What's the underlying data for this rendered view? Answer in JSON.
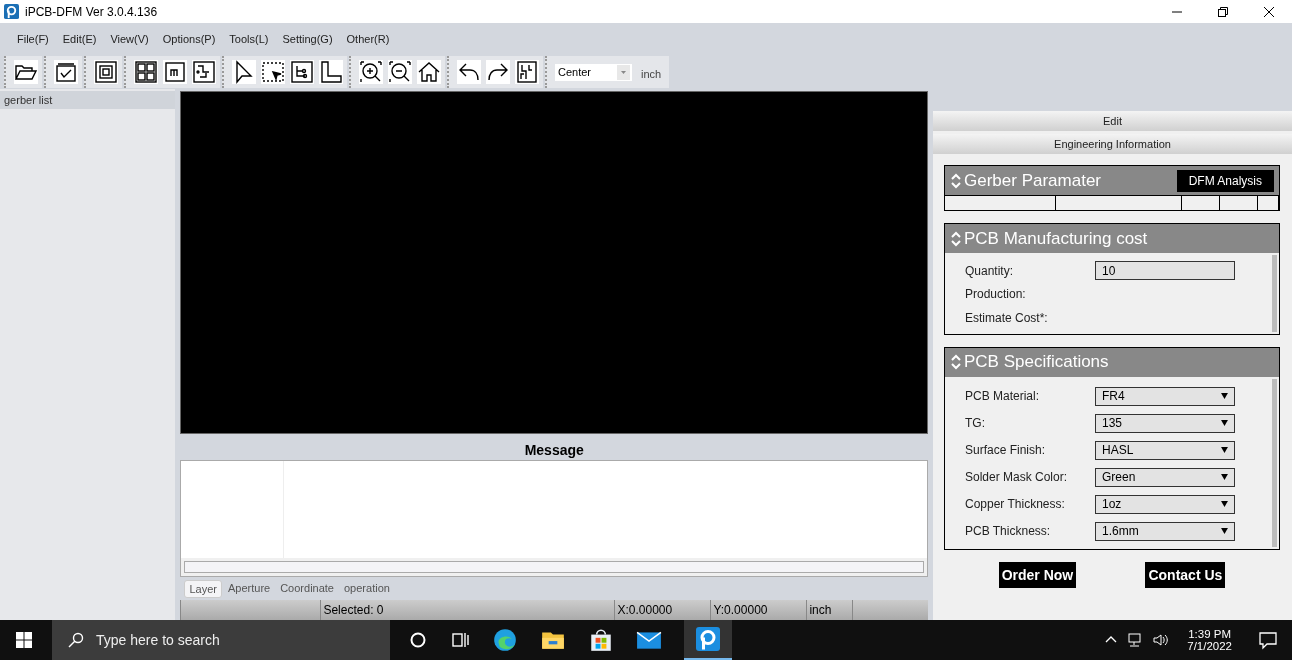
{
  "window": {
    "title": "iPCB-DFM Ver 3.0.4.136"
  },
  "menu": [
    "File(F)",
    "Edit(E)",
    "View(V)",
    "Options(P)",
    "Tools(L)",
    "Setting(G)",
    "Other(R)"
  ],
  "toolbar": {
    "origin": "Center",
    "unit": "inch"
  },
  "sidebar": {
    "title": "gerber list"
  },
  "message": {
    "title": "Message"
  },
  "tabs": [
    {
      "label": "Layer",
      "selected": true
    },
    {
      "label": "Aperture",
      "selected": false
    },
    {
      "label": "Coordinate",
      "selected": false
    },
    {
      "label": "operation",
      "selected": false
    }
  ],
  "status_bar": {
    "selected": "Selected: 0",
    "x": "X:0.00000",
    "y": "Y:0.00000",
    "unit": "inch"
  },
  "right_panel": {
    "bars": [
      "Edit",
      "Engineering Information"
    ],
    "gerber": {
      "title": "Gerber Paramater",
      "button": "DFM Analysis"
    },
    "cost": {
      "title": "PCB Manufacturing cost",
      "fields": [
        {
          "kind": "input",
          "label": "Quantity:",
          "value": "10"
        },
        {
          "kind": "label",
          "label": "Production:"
        },
        {
          "kind": "label",
          "label": "Estimate Cost*:"
        }
      ]
    },
    "specs": {
      "title": "PCB Specifications",
      "fields": [
        {
          "label": "PCB Material:",
          "value": "FR4"
        },
        {
          "label": "TG:",
          "value": "135"
        },
        {
          "label": "Surface Finish:",
          "value": "HASL"
        },
        {
          "label": "Solder Mask Color:",
          "value": "Green"
        },
        {
          "label": "Copper Thickness:",
          "value": "1oz"
        },
        {
          "label": "PCB Thickness:",
          "value": "1.6mm"
        }
      ]
    },
    "buttons": [
      "Order Now",
      "Contact Us"
    ]
  },
  "taskbar": {
    "search_placeholder": "Type here to search",
    "time": "1:39 PM",
    "date": "7/1/2022"
  }
}
